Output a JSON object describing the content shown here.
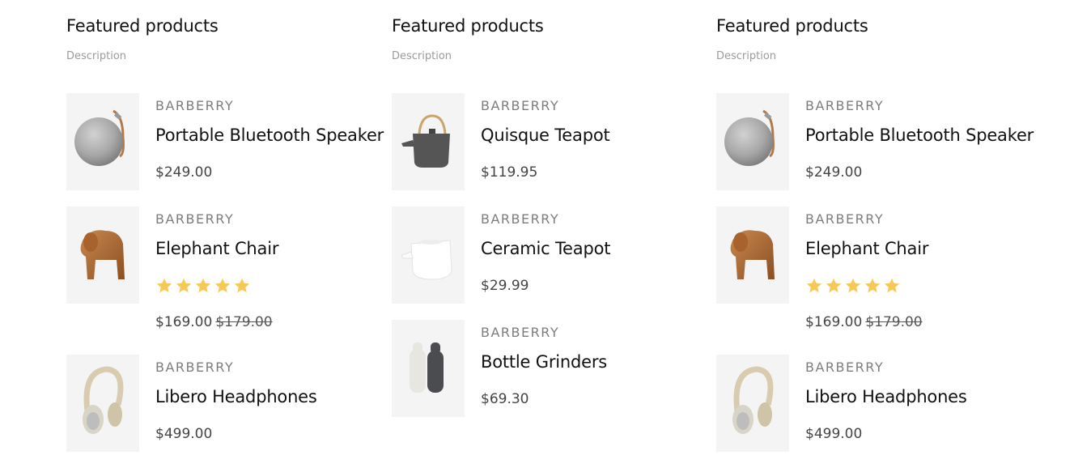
{
  "columns": [
    {
      "title": "Featured products",
      "description": "Description",
      "products": [
        {
          "brand": "BARBERRY",
          "name": "Portable Bluetooth Speaker",
          "price": "$249.00",
          "image": "speaker-image"
        },
        {
          "brand": "BARBERRY",
          "name": "Elephant Chair",
          "price": "$169.00",
          "old_price": "$179.00",
          "rating": 5,
          "image": "elephant-chair-image"
        },
        {
          "brand": "BARBERRY",
          "name": "Libero Headphones",
          "price": "$499.00",
          "image": "headphones-image"
        }
      ]
    },
    {
      "title": "Featured products",
      "description": "Description",
      "products": [
        {
          "brand": "BARBERRY",
          "name": "Quisque Teapot",
          "price": "$119.95",
          "image": "dark-teapot-image"
        },
        {
          "brand": "BARBERRY",
          "name": "Ceramic Teapot",
          "price": "$29.99",
          "image": "white-teapot-image"
        },
        {
          "brand": "BARBERRY",
          "name": "Bottle Grinders",
          "price": "$69.30",
          "image": "grinders-image"
        }
      ]
    },
    {
      "title": "Featured products",
      "description": "Description",
      "products": [
        {
          "brand": "BARBERRY",
          "name": "Portable Bluetooth Speaker",
          "price": "$249.00",
          "image": "speaker-image"
        },
        {
          "brand": "BARBERRY",
          "name": "Elephant Chair",
          "price": "$169.00",
          "old_price": "$179.00",
          "rating": 5,
          "image": "elephant-chair-image"
        },
        {
          "brand": "BARBERRY",
          "name": "Libero Headphones",
          "price": "$499.00",
          "image": "headphones-image"
        }
      ]
    }
  ],
  "colors": {
    "star": "#f6c957",
    "text": "#111111",
    "muted": "#9a9a9a",
    "thumb_bg": "#f4f4f4"
  }
}
